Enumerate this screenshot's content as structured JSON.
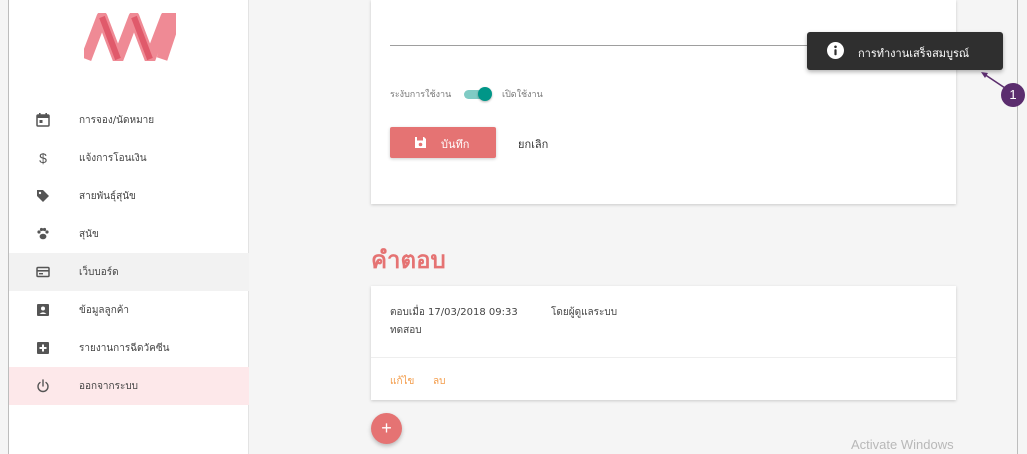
{
  "sidebar": {
    "items": [
      {
        "label": "การจอง/นัดหมาย",
        "icon": "calendar-icon"
      },
      {
        "label": "แจ้งการโอนเงิน",
        "icon": "dollar-icon"
      },
      {
        "label": "สายพันธุ์สุนัข",
        "icon": "tag-icon"
      },
      {
        "label": "สุนัข",
        "icon": "paw-icon"
      },
      {
        "label": "เว็บบอร์ด",
        "icon": "card-icon"
      },
      {
        "label": "ข้อมูลลูกค้า",
        "icon": "account-box-icon"
      },
      {
        "label": "รายงานการฉีดวัคซีน",
        "icon": "plus-box-icon"
      },
      {
        "label": "ออกจากระบบ",
        "icon": "power-icon"
      }
    ]
  },
  "form": {
    "status_label": "ระงับการใช้งาน",
    "enabled_label": "เปิดใช้งาน",
    "save_label": "บันทึก",
    "cancel_label": "ยกเลิก"
  },
  "answers": {
    "heading": "คำตอบ",
    "items": [
      {
        "meta": "ตอบเมื่อ 17/03/2018 09:33",
        "author": "โดยผู้ดูแลระบบ",
        "body": "ทดสอบ",
        "edit_label": "แก้ไข",
        "delete_label": "ลบ"
      }
    ]
  },
  "fab_label": "+",
  "toast": {
    "message": "การทำงานเสร็จสมบูรณ์",
    "icon": "info-icon"
  },
  "annotation_marker": "1",
  "watermark": "Activate Windows",
  "colors": {
    "accent": "#e57373",
    "toggle": "#009688",
    "link": "#f39c4a",
    "toast_bg": "#2f2f2f",
    "marker": "#5b2d6e"
  }
}
